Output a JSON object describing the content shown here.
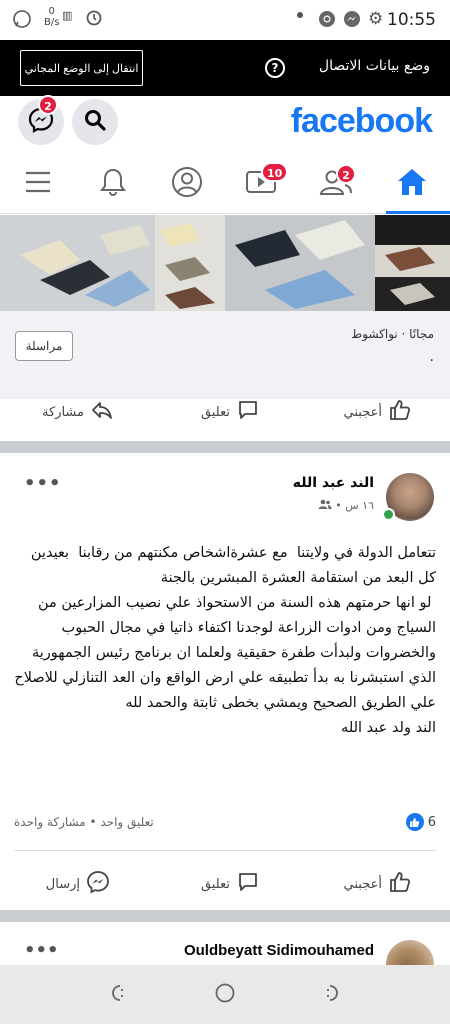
{
  "status_bar": {
    "time": "10:55",
    "speed_value": "0",
    "speed_unit": "B/s"
  },
  "data_banner": {
    "free_mode_button": "انتقال إلى الوضع المجاني",
    "data_mode_label": "وضع بيانات الاتصال",
    "help_glyph": "?"
  },
  "header": {
    "logo": "facebook",
    "messenger_badge": "2"
  },
  "nav": {
    "watch_badge": "10",
    "friends_badge": "2"
  },
  "promo": {
    "seller_line": "مجانًا · نواكشوط",
    "dot_line": ".",
    "message_button": "مراسلة"
  },
  "promo_actions": {
    "like": "أعجبني",
    "comment": "تعليق",
    "share": "مشاركة"
  },
  "post": {
    "author": "الند عبد الله",
    "time": "١٦ س •",
    "text": "تتعامل الدولة في ولايتنا  مع عشرةاشخاص مكنتهم من رقابنا  بعيدين كل البعد من استقامة العشرة المبشرين بالجنة\n لو انها حرمتهم هذه السنة من الاستحواذ علي نصيب المزارعين من السياج ومن ادوات الزراعة لوجدنا اكتفاء ذاتيا في مجال الحبوب والخضروات ولبدأت طفرة حقيقية ولعلما ان برنامج رئيس الجمهورية الذي استبشرنا به بدأ تطبيقه علي ارض الواقع وان العد التنازلي للاصلاح علي الطريق الصحيح ويمشي بخطى ثابتة والحمد لله\nالند ولد عبد الله",
    "likes": "6",
    "stats": "تعليق واحد • مشاركة واحدة",
    "more": "•••"
  },
  "post_actions": {
    "like": "أعجبني",
    "comment": "تعليق",
    "send": "إرسال"
  },
  "next_post": {
    "author": "Ouldbeyatt Sidimouhamed",
    "more": "•••"
  },
  "colors": {
    "brand": "#1877f2",
    "badge": "#e41e3f",
    "online": "#31a24c"
  }
}
